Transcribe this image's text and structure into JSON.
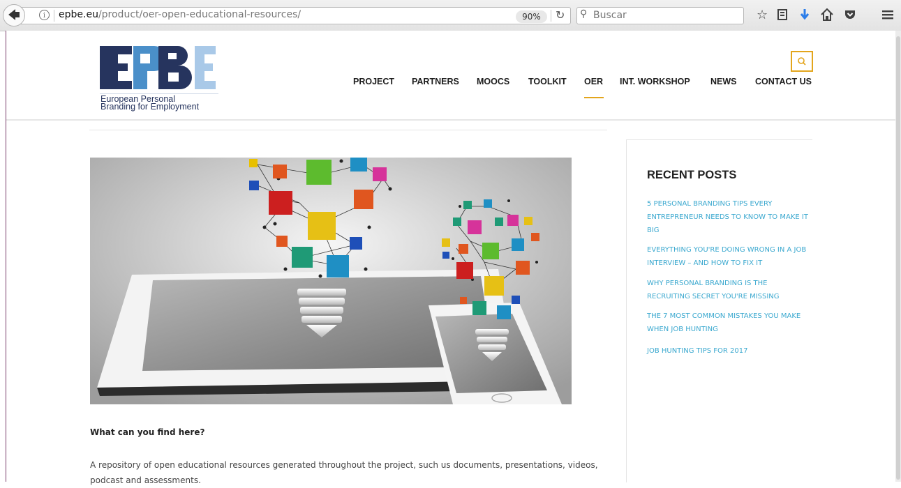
{
  "browser": {
    "url_host": "epbe.eu",
    "url_path": "/product/oer-open-educational-resources/",
    "zoom": "90%",
    "search_placeholder": "Buscar"
  },
  "header": {
    "logo_text": "EPBE",
    "logo_caption": "European Personal\nBranding for Employment",
    "nav": [
      "PROJECT",
      "PARTNERS",
      "MOOCS",
      "TOOLKIT",
      "OER",
      "INT. WORKSHOP",
      "NEWS",
      "CONTACT US"
    ],
    "active_nav": "OER"
  },
  "colors": {
    "accent": "#e3a51c",
    "link": "#3aa8cf",
    "logo_dark": "#26345e",
    "logo_mid": "#4a8fc9",
    "logo_light": "#a9c9e8"
  },
  "content": {
    "section_heading": "What can you find here?",
    "section_text": "A repository of open educational resources generated throughout the project, such us documents, presentations, videos, podcast and assessments."
  },
  "sidebar": {
    "title": "RECENT POSTS",
    "posts": [
      "5 PERSONAL BRANDING TIPS EVERY ENTREPRENEUR NEEDS TO KNOW TO MAKE IT BIG",
      "EVERYTHING YOU'RE DOING WRONG IN A JOB INTERVIEW – AND HOW TO FIX IT",
      "WHY PERSONAL BRANDING IS THE RECRUITING SECRET YOU'RE MISSING",
      "THE 7 MOST COMMON MISTAKES YOU MAKE WHEN JOB HUNTING",
      "JOB HUNTING TIPS FOR 2017"
    ]
  }
}
